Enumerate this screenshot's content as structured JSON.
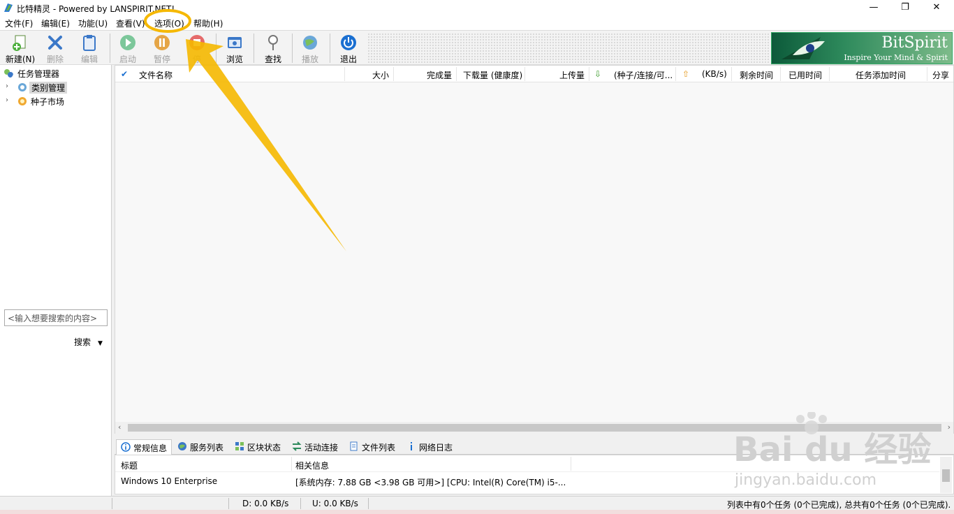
{
  "window": {
    "title": "比特精灵 - Powered by LANSPIRIT.NET!",
    "controls": {
      "minimize": "—",
      "maximize": "❐",
      "close": "✕"
    }
  },
  "menu": [
    "文件(F)",
    "编辑(E)",
    "功能(U)",
    "查看(V)",
    "选项(O)",
    "帮助(H)"
  ],
  "toolbar": {
    "new": "新建(N)",
    "delete": "删除",
    "edit": "编辑",
    "start": "启动",
    "pause": "暂停",
    "stop": "停",
    "browse": "浏览",
    "find": "查找",
    "play": "播放",
    "exit": "退出"
  },
  "banner": {
    "brand": "BitSpirit",
    "slogan": "Inspire Your Mind & Spirit"
  },
  "tree": {
    "root": "任务管理器",
    "category": "类别管理",
    "market": "种子市场"
  },
  "search": {
    "placeholder": "<输入想要搜索的内容>",
    "button": "搜索"
  },
  "list_columns": [
    "文件名称",
    "大小",
    "完成量",
    "下载量 (健康度)",
    "上传量",
    "(种子/连接/可...",
    "(KB/s)",
    "剩余时间",
    "已用时间",
    "任务添加时间",
    "分享"
  ],
  "bottom_tabs": [
    "常规信息",
    "服务列表",
    "区块状态",
    "活动连接",
    "文件列表",
    "网络日志"
  ],
  "info": {
    "header_title": "标题",
    "header_info": "相关信息",
    "row_title": "Windows 10 Enterprise",
    "row_info": "[系统内存: 7.88 GB <3.98 GB 可用>] [CPU: Intel(R) Core(TM) i5-..."
  },
  "status": {
    "download": "D: 0.0 KB/s",
    "upload": "U: 0.0 KB/s",
    "summary": "列表中有0个任务 (0个已完成), 总共有0个任务 (0个已完成)."
  },
  "watermark": {
    "brand": "Bai du 经验",
    "url": "jingyan.baidu.com"
  },
  "colors": {
    "highlight": "#f5b800",
    "banner": "#1f7a4c",
    "accent": "#1a6fd1"
  }
}
